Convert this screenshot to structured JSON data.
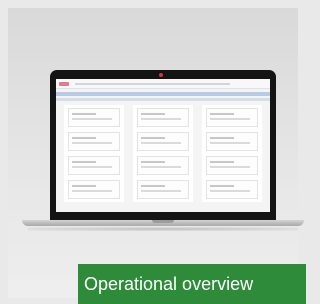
{
  "caption": {
    "text": "Operational overview"
  },
  "colors": {
    "caption_background": "#2e8b3a",
    "caption_text": "#ffffff",
    "camera": "#d9304a"
  },
  "icons": {
    "laptop": "laptop-icon"
  }
}
